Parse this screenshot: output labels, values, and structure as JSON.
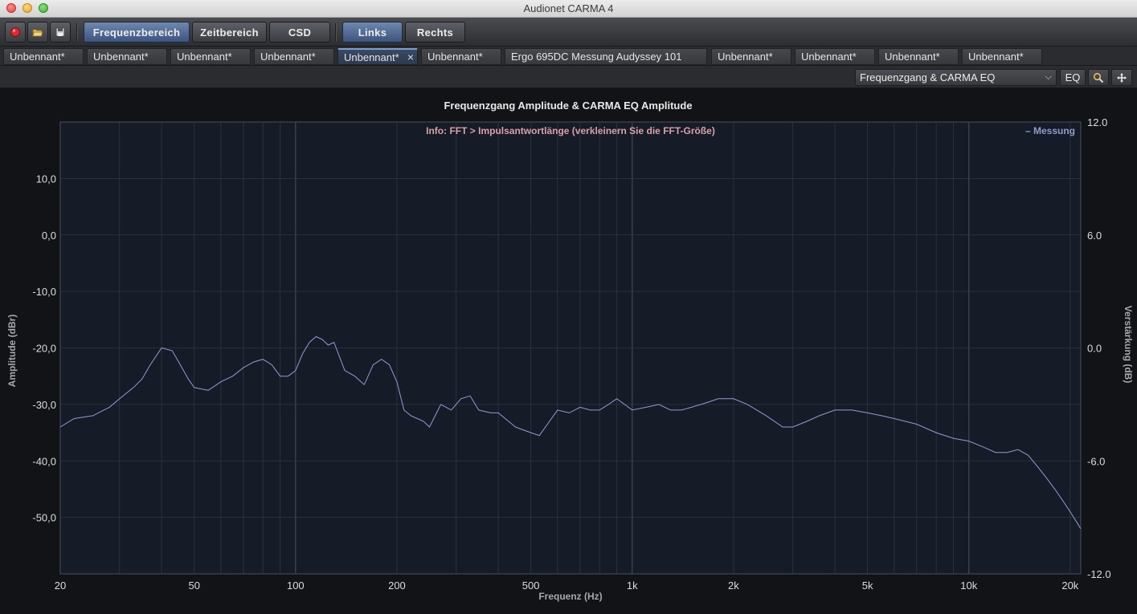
{
  "window": {
    "title": "Audionet CARMA 4"
  },
  "toolbar": {
    "record_icon": "record-icon",
    "open_icon": "folder-open-icon",
    "save_icon": "save-disk-icon",
    "view_buttons": [
      "Frequenzbereich",
      "Zeitbereich",
      "CSD"
    ],
    "channel_buttons": [
      "Links",
      "Rechts"
    ]
  },
  "tabs": [
    "Unbennant*",
    "Unbennant*",
    "Unbennant*",
    "Unbennant*",
    "Unbennant*",
    "Unbennant*",
    "Ergo 695DC Messung Audyssey 101",
    "Unbennant*",
    "Unbennant*",
    "Unbennant*",
    "Unbennant*"
  ],
  "active_tab_close": "×",
  "view": {
    "selected": "Frequenzgang & CARMA EQ",
    "eq_label": "EQ",
    "zoom_icon": "magnifier-icon",
    "pan_icon": "move-arrows-icon"
  },
  "colors": {
    "plot_bg": "#161b28",
    "grid": "#303642",
    "grid_major": "#3e4450",
    "curve": "#8f9dcf",
    "active_button": "#4a6590"
  },
  "chart_data": {
    "type": "line",
    "title": "Frequenzgang Amplitude & CARMA EQ Amplitude",
    "xlabel": "Frequenz (Hz)",
    "ylabel": "Amplitude (dBr)",
    "y2label": "Verstärkung (dB)",
    "info": "Info: FFT > Impulsantwortlänge (verkleinern Sie die FFT-Größe)",
    "x_scale": "log",
    "xlim": [
      20,
      21500
    ],
    "ylim": [
      -60,
      20
    ],
    "y2lim": [
      -12,
      12
    ],
    "x_ticks": [
      20,
      50,
      100,
      200,
      500,
      1000,
      2000,
      5000,
      10000,
      20000
    ],
    "x_tick_labels": [
      "20",
      "50",
      "100",
      "200",
      "500",
      "1k",
      "2k",
      "5k",
      "10k",
      "20k"
    ],
    "y_ticks": [
      10,
      0,
      -10,
      -20,
      -30,
      -40,
      -50
    ],
    "y_tick_labels": [
      "10,0",
      "0,0",
      "-10,0",
      "-20,0",
      "-30,0",
      "-40,0",
      "-50,0"
    ],
    "y2_ticks": [
      12,
      6,
      0,
      -6,
      -12
    ],
    "y2_tick_labels": [
      "12.0",
      "6.0",
      "0.0",
      "-6.0",
      "-12.0"
    ],
    "legend": "– Messung",
    "legend_position": "top-right",
    "grid": true,
    "series": [
      {
        "name": "Messung",
        "x": [
          20,
          22,
          25,
          28,
          30,
          33,
          35,
          37,
          40,
          43,
          45,
          48,
          50,
          55,
          60,
          65,
          70,
          75,
          80,
          85,
          90,
          95,
          100,
          105,
          110,
          115,
          120,
          125,
          130,
          140,
          150,
          160,
          170,
          180,
          190,
          200,
          210,
          220,
          230,
          240,
          250,
          270,
          290,
          310,
          330,
          350,
          380,
          400,
          450,
          500,
          530,
          560,
          600,
          650,
          700,
          750,
          800,
          850,
          900,
          950,
          1000,
          1100,
          1200,
          1300,
          1400,
          1500,
          1600,
          1700,
          1800,
          2000,
          2200,
          2500,
          2800,
          3000,
          3300,
          3600,
          4000,
          4500,
          5000,
          5500,
          6000,
          7000,
          8000,
          9000,
          10000,
          11000,
          12000,
          13000,
          14000,
          15000,
          16000,
          17000,
          18000,
          19000,
          20000,
          21000,
          21500
        ],
        "y": [
          -34,
          -32.5,
          -32,
          -30.5,
          -29,
          -27,
          -25.5,
          -23,
          -20,
          -20.5,
          -22.5,
          -25.5,
          -27,
          -27.5,
          -26,
          -25,
          -23.5,
          -22.5,
          -22,
          -23,
          -25,
          -25,
          -24,
          -21,
          -19,
          -18,
          -18.5,
          -19.5,
          -19,
          -24,
          -25,
          -26.5,
          -23,
          -22,
          -23,
          -26,
          -31,
          -32,
          -32.5,
          -33,
          -34,
          -30,
          -31,
          -29,
          -28.5,
          -31,
          -31.5,
          -31.5,
          -34,
          -35,
          -35.5,
          -33.5,
          -31,
          -31.5,
          -30.5,
          -31,
          -31,
          -30,
          -29,
          -30,
          -31,
          -30.5,
          -30,
          -31,
          -31,
          -30.5,
          -30,
          -29.5,
          -29,
          -29,
          -30,
          -32,
          -34,
          -34,
          -33,
          -32,
          -31,
          -31,
          -31.5,
          -32,
          -32.5,
          -33.5,
          -35,
          -36,
          -36.5,
          -37.5,
          -38.5,
          -38.5,
          -38,
          -39,
          -41,
          -43,
          -45,
          -47,
          -49,
          -51,
          -52
        ]
      }
    ]
  }
}
